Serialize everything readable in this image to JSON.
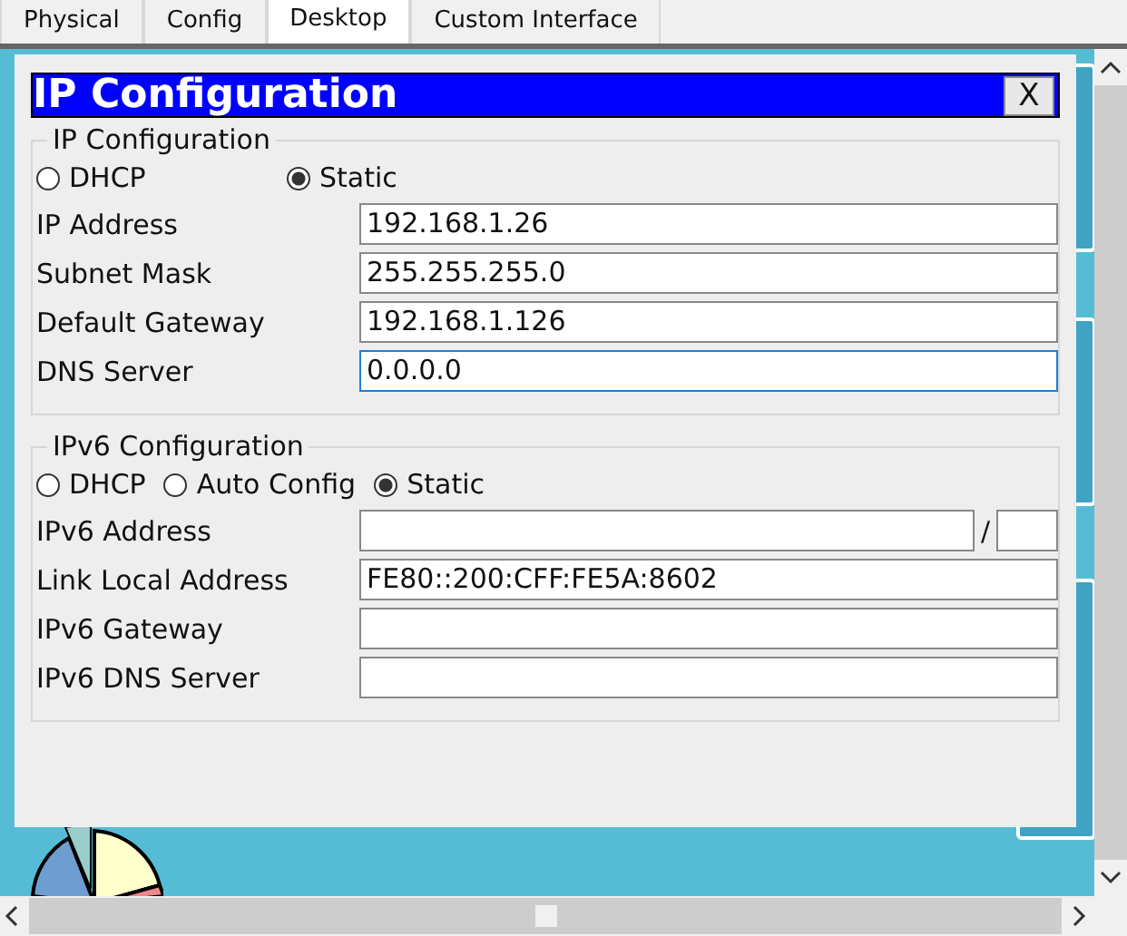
{
  "tabs": [
    {
      "label": "Physical",
      "selected": false
    },
    {
      "label": "Config",
      "selected": false
    },
    {
      "label": "Desktop",
      "selected": true
    },
    {
      "label": "Custom Interface",
      "selected": false
    }
  ],
  "dialog": {
    "title": "IP Configuration",
    "close_label": "X",
    "ipv4": {
      "legend": "IP Configuration",
      "modes": [
        {
          "label": "DHCP",
          "selected": false
        },
        {
          "label": "Static",
          "selected": true
        }
      ],
      "fields": [
        {
          "label": "IP Address",
          "value": "192.168.1.26",
          "focused": false
        },
        {
          "label": "Subnet Mask",
          "value": "255.255.255.0",
          "focused": false
        },
        {
          "label": "Default Gateway",
          "value": "192.168.1.126",
          "focused": false
        },
        {
          "label": "DNS Server",
          "value": "0.0.0.0",
          "focused": true
        }
      ]
    },
    "ipv6": {
      "legend": "IPv6 Configuration",
      "modes": [
        {
          "label": "DHCP",
          "selected": false
        },
        {
          "label": "Auto Config",
          "selected": false
        },
        {
          "label": "Static",
          "selected": true
        }
      ],
      "fields": [
        {
          "label": "IPv6 Address",
          "kind": "prefixed",
          "separator": "/",
          "focused": false
        },
        {
          "label": "Link Local Address",
          "kind": "plain",
          "value": "FE80::200:CFF:FE5A:8602",
          "focused": false
        },
        {
          "label": "IPv6 Gateway",
          "kind": "plain",
          "focused": false
        },
        {
          "label": "IPv6 DNS Server",
          "kind": "plain",
          "focused": false
        }
      ]
    }
  }
}
